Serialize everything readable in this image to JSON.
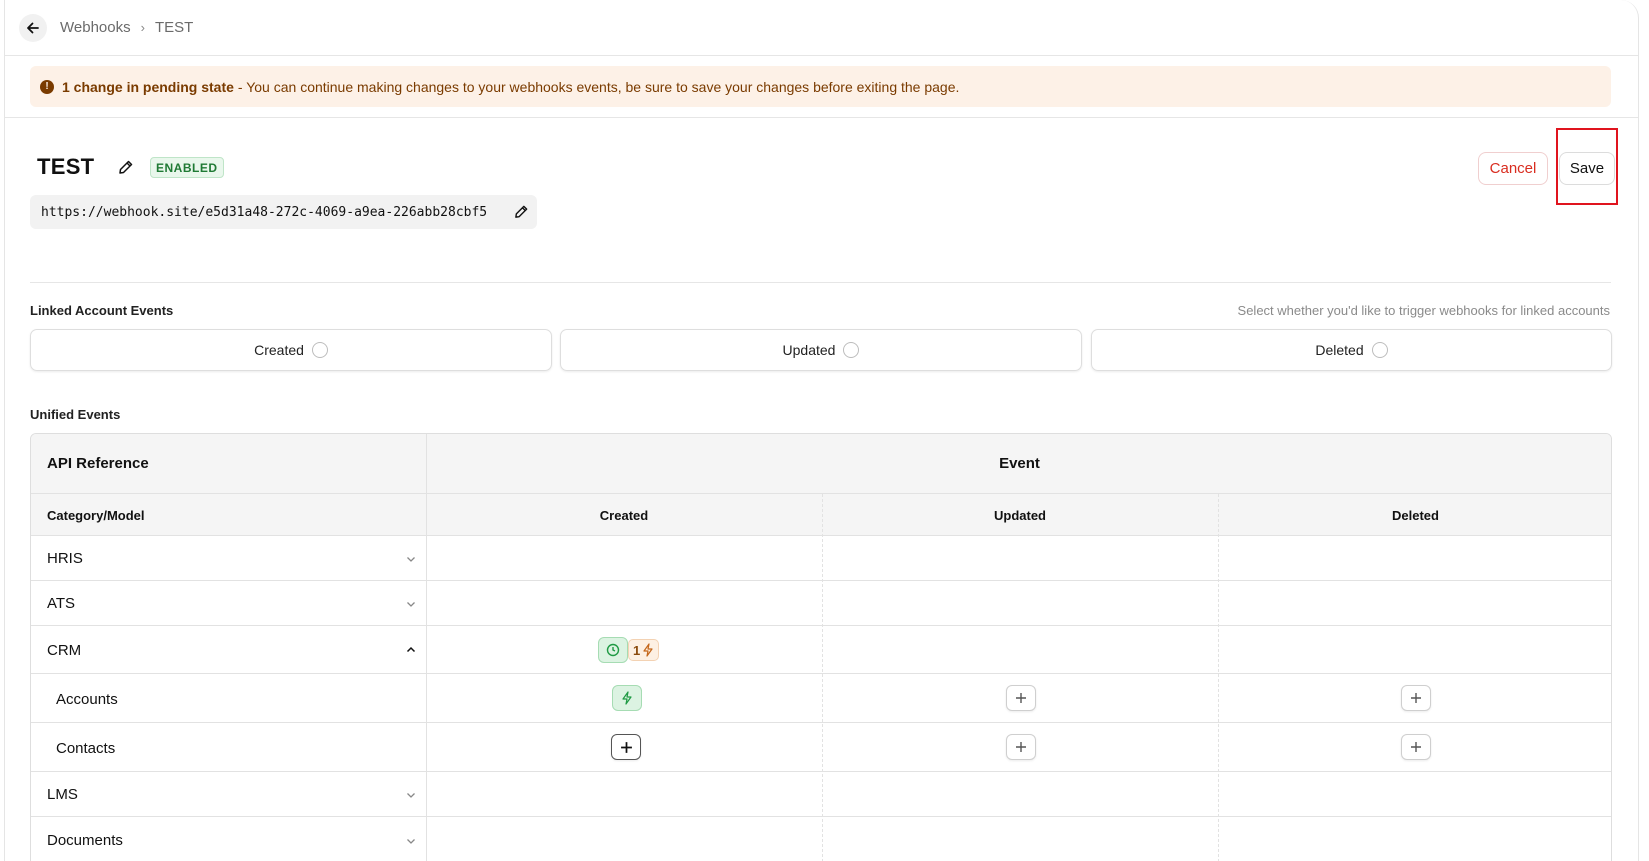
{
  "breadcrumb": {
    "parent": "Webhooks",
    "separator": "›",
    "current": "TEST"
  },
  "banner": {
    "strong": "1 change in pending state",
    "text": "- You can continue making changes to your webhooks events, be sure to save your changes before exiting the page.",
    "icon_text": "!"
  },
  "webhook": {
    "title": "TEST",
    "status": "ENABLED",
    "url": "https://webhook.site/e5d31a48-272c-4069-a9ea-226abb28cbf5"
  },
  "actions": {
    "cancel_label": "Cancel",
    "save_label": "Save"
  },
  "linked_account": {
    "label": "Linked Account Events",
    "hint": "Select whether you'd like to trigger webhooks for linked accounts",
    "options": [
      "Created",
      "Updated",
      "Deleted"
    ]
  },
  "unified": {
    "label": "Unified Events",
    "header_left": "API Reference",
    "header_right": "Event",
    "subheader_left": "Category/Model",
    "columns": [
      "Created",
      "Updated",
      "Deleted"
    ],
    "rows": [
      {
        "name": "HRIS",
        "expanded": false
      },
      {
        "name": "ATS",
        "expanded": false
      },
      {
        "name": "CRM",
        "expanded": true,
        "created_count": "1"
      },
      {
        "name": "Accounts",
        "created_state": "active",
        "updated_state": "add",
        "deleted_state": "add"
      },
      {
        "name": "Contacts",
        "created_state": "add-hover",
        "updated_state": "add",
        "deleted_state": "add"
      },
      {
        "name": "LMS",
        "expanded": false
      },
      {
        "name": "Documents",
        "expanded": false
      }
    ]
  },
  "icons": {
    "back": "arrow-left-icon",
    "edit": "pencil-icon",
    "chevron_down": "chevron-down-icon",
    "chevron_up": "chevron-up-icon",
    "plus": "plus-icon",
    "bolt": "bolt-icon",
    "clock": "clock-icon"
  },
  "colors": {
    "banner_bg": "#fdf1e7",
    "banner_text": "#7a3b00",
    "enabled_green": "#1f7a34",
    "cancel_red": "#d92d20",
    "highlight_red": "#e0141e",
    "active_green_bg": "#dcf3e2"
  }
}
